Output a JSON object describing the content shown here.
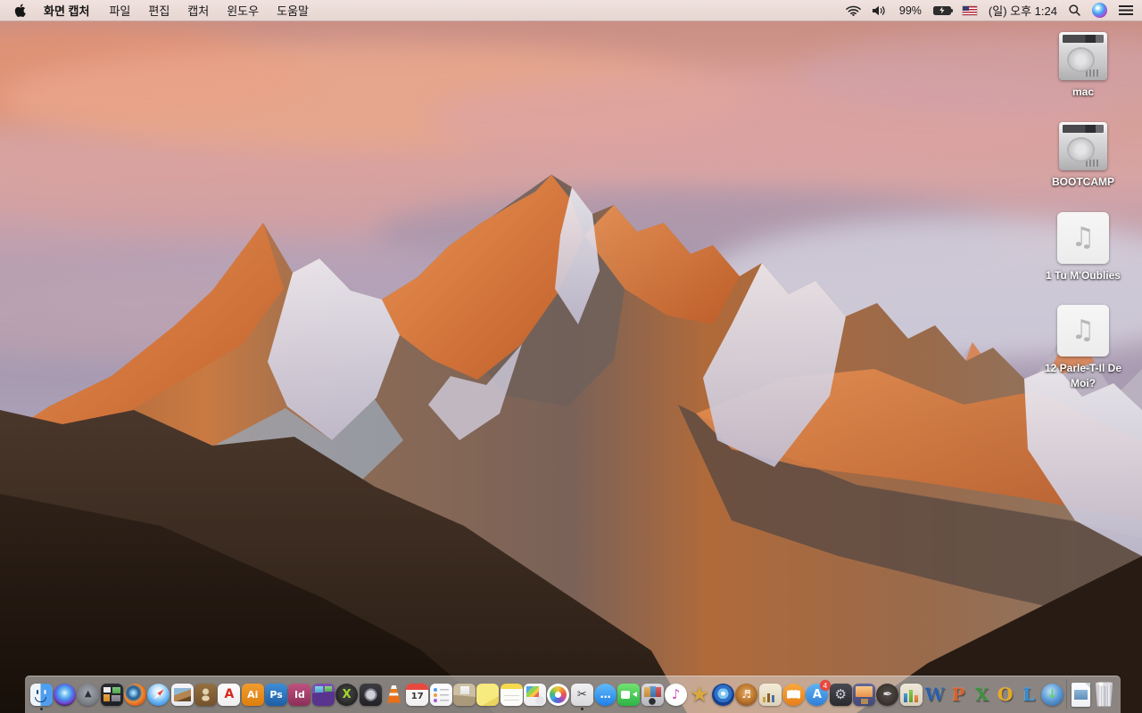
{
  "menu_bar": {
    "menus": [
      {
        "label": "화면 캡처",
        "app": true
      },
      {
        "label": "파일"
      },
      {
        "label": "편집"
      },
      {
        "label": "캡처"
      },
      {
        "label": "윈도우"
      },
      {
        "label": "도움말"
      }
    ],
    "status": {
      "battery_percent": "99%",
      "clock": "(일) 오후 1:24"
    },
    "status_icons": [
      "wifi-icon",
      "volume-icon",
      "battery-charging-icon",
      "us-flag-input-icon",
      "spotlight-search-icon",
      "siri-icon",
      "notification-center-icon"
    ]
  },
  "desktop": {
    "icons": [
      {
        "id": "mac",
        "label": "mac",
        "type": "drive"
      },
      {
        "id": "bootcamp",
        "label": "BOOTCAMP",
        "type": "drive"
      },
      {
        "id": "tu-moublies",
        "label": "1 Tu M'Oublies",
        "type": "audio",
        "glyph": "♫"
      },
      {
        "id": "parle-t-il-de-moi",
        "label": "12 Parle-T-Il De Moi?",
        "type": "audio",
        "glyph": "♫"
      }
    ]
  },
  "dock": {
    "items": [
      {
        "name": "finder",
        "cls": "finder",
        "bg": "linear-gradient(90deg,#eff4f9 0 46%,#4f9ef0 46%)",
        "running": true
      },
      {
        "name": "siri",
        "cls": "circle",
        "bg": "radial-gradient(circle at 50% 42%,#eaf6ff 0%,#7cc5f2 20%,#4383e8 45%,#7a3fd0 63%,#191921 80%)"
      },
      {
        "name": "launchpad",
        "cls": "circle",
        "bg": "radial-gradient(circle at 50% 42%,#a6abb3 0%,#787d85 65%,#585d64 100%)",
        "glyph": "▲",
        "glyphColor": "#2c3036",
        "glyphSize": 10
      },
      {
        "name": "mission-control",
        "bg": "linear-gradient(#ededed,#ededed) 3px 4px/8px 6px no-repeat,linear-gradient(#7bc47b,#4fa84f) 13px 4px/9px 7px no-repeat,linear-gradient(#e8a23f,#d68a2a) 3px 12px/7px 8px no-repeat,linear-gradient(#9a9aa4,#7a7a84) 12px 13px/10px 7px no-repeat,linear-gradient(#2a2c31,#1e2024)"
      },
      {
        "name": "firefox",
        "cls": "circle",
        "bg": "radial-gradient(circle at 42% 42%,#cfe8f7 0%,#6fb2dd 15%,#2a5d8f 30%,#3a6fa0 38%,#ef8f2e 48%,#e2621c 68%,#c24e12 100%)"
      },
      {
        "name": "safari",
        "cls": "circle safari",
        "bg": "radial-gradient(circle at 50% 35%,#f8fbff 0%,#d4ebfb 25%,#62b2f2 60%,#1f70d0 100%)"
      },
      {
        "name": "preview",
        "bg": "linear-gradient(160deg,#90b8d6 0 38%,#b5854f 38% 72%,#6b4a2a 72%) 3px 5px/19px 15px no-repeat,linear-gradient(#f6f6f8,#e8e8ec)"
      },
      {
        "name": "contacts",
        "bg": "radial-gradient(circle at 50% 36%,#e2d2ae 0 3px,transparent 4px) no-repeat,radial-gradient(ellipse 7px 5px at 50% 66%,#e2d2ae 60%,transparent 62%) no-repeat,linear-gradient(#95703f,#74522c)"
      },
      {
        "name": "acrobat-reader",
        "bg": "linear-gradient(#fdfdfd,#eeeeee)",
        "glyph": "A",
        "glyphColor": "#d6281e",
        "glyphSize": 14,
        "bold": true
      },
      {
        "name": "illustrator",
        "bg": "linear-gradient(#f09c2e,#de7f0e)",
        "glyph": "Ai",
        "glyphColor": "#ffffff",
        "glyphSize": 11,
        "bold": true
      },
      {
        "name": "photoshop",
        "bg": "linear-gradient(#3e8ed6,#1e5ea6)",
        "glyph": "Ps",
        "glyphColor": "#ffffff",
        "glyphSize": 11,
        "bold": true
      },
      {
        "name": "indesign",
        "bg": "linear-gradient(#bf5280,#8c2f58)",
        "glyph": "Id",
        "glyphColor": "#ffffff",
        "glyphSize": 11,
        "bold": true
      },
      {
        "name": "toast-titanium",
        "bg": "linear-gradient(#7fd8e8,#4fa8c8) 3px 3px/9px 7px no-repeat,linear-gradient(#8fd87f,#4fa84f) 14px 3px/8px 6px no-repeat,linear-gradient(175deg,#7a4fb2 0 40%,#58348e 40%)"
      },
      {
        "name": "macx-dvd",
        "cls": "circle",
        "bg": "radial-gradient(circle at 50% 45%,#3a3a3a 0 35%,#111111 100%)",
        "glyph": "X",
        "glyphColor": "#a4d92e",
        "glyphSize": 13,
        "bold": true
      },
      {
        "name": "disc-burner",
        "bg": "radial-gradient(circle at 50% 50%,#d0d0d8 0 5px,#888890 5px 7px,transparent 7px) no-repeat,linear-gradient(#3c3c42,#222226)"
      },
      {
        "name": "vlc",
        "cls": "vlc",
        "bg": "transparent"
      },
      {
        "name": "calendar",
        "cls": "calendar",
        "bg": "linear-gradient(#fcfcfc,#f0f0f0)",
        "glyph": "17",
        "glyphColor": "#333333",
        "glyphSize": 10
      },
      {
        "name": "reminders",
        "bg": "radial-gradient(circle at 6px 7px,#4f9fe8 1.8px,transparent 2.3px),radial-gradient(circle at 6px 13px,#e8a23f 1.8px,transparent 2.3px),radial-gradient(circle at 6px 19px,#9f5fd6 1.8px,transparent 2.3px),linear-gradient(#bfbfc4,#bfbfc4) 11px 6px/10px 1.5px no-repeat,linear-gradient(#bfbfc4,#bfbfc4) 11px 12px/10px 1.5px no-repeat,linear-gradient(#bfbfc4,#bfbfc4) 11px 18px/10px 1.5px no-repeat,linear-gradient(#ffffff,#f2f2f4)"
      },
      {
        "name": "stuffit-expander",
        "bg": "linear-gradient(#f6f6f6,#e2e2e2) 8px 3px/10px 9px no-repeat,linear-gradient(185deg,#cdbfa2 0 55%,#ab9a7a 55%)"
      },
      {
        "name": "stickies",
        "bg": "linear-gradient(150deg,#f7ea7e 0 72%,#e8d45f 72%)"
      },
      {
        "name": "notes",
        "bg": "linear-gradient(#d9d9d5,#d9d9d5) 4px 13px/17px 1px no-repeat,linear-gradient(#d9d9d5,#d9d9d5) 4px 18px/17px 1px no-repeat,linear-gradient(180deg,#f6d94d 0 6px,#fcfcf9 6px)"
      },
      {
        "name": "image-capture",
        "bg": "linear-gradient(135deg,#4fa8e8 0 30%,#8fd64f 30% 55%,#f5c542 55% 75%,#e8654f 75%) 3px 3px/14px 12px no-repeat,radial-gradient(circle at 18px 19px,#e2e2e8 4.5px,transparent 5px),linear-gradient(#f8f8fa,#ececf0)"
      },
      {
        "name": "photos",
        "cls": "circle photos",
        "bg": "#ffffff"
      },
      {
        "name": "grab-screen-capture",
        "bg": "linear-gradient(#f2f2f4,#d8d8dc)",
        "glyph": "✂",
        "glyphColor": "#3a3a3e",
        "glyphSize": 13,
        "running": true
      },
      {
        "name": "messages",
        "cls": "circle",
        "bg": "linear-gradient(#62baf8,#1f7fe8)",
        "glyph": "…",
        "glyphColor": "#ffffff",
        "glyphSize": 12,
        "bold": true
      },
      {
        "name": "facetime",
        "cls": "facetime",
        "bg": "linear-gradient(#72e273,#2cb445)"
      },
      {
        "name": "photo-booth",
        "bg": "linear-gradient(#e2b45f,#c28a3a) 3px 4px/7px 11px no-repeat,linear-gradient(#5f9fd8,#3a6fa8) 9px 3px/7px 12px no-repeat,linear-gradient(#d65f5f,#a83a3a) 15px 4px/7px 11px no-repeat,radial-gradient(circle at 12px 20px,#2c2c30 3.5px,transparent 4px),linear-gradient(#dcdce2,#b6b6be)"
      },
      {
        "name": "itunes",
        "cls": "circle",
        "bg": "radial-gradient(circle at 50% 45%,#ffffff 55%,#e8f2fa 100%)",
        "glyph": "♪",
        "glyphColor": "#d04fc0",
        "glyphSize": 15
      },
      {
        "name": "imovie",
        "cls": "imovie",
        "glyph": "★",
        "glyphColor": "#d9a93f",
        "glyphSize": 24
      },
      {
        "name": "dvd-player",
        "cls": "circle",
        "bg": "radial-gradient(circle at 50% 45%,#f0f8ff 0 2.5px,#7fc4f0 2.5px 6px,#2f6fc8 6px 10px,#16408c 10px)"
      },
      {
        "name": "garageband",
        "cls": "circle",
        "bg": "radial-gradient(circle at 50% 42%,#e8ab62 0%,#b5712a 55%,#6f4418 100%)",
        "glyph": "♬",
        "glyphColor": "#ffffff",
        "glyphSize": 12
      },
      {
        "name": "office-documents",
        "bg": "linear-gradient(#c9a23f,#c9a23f) 4px 15px/3px 6px no-repeat,linear-gradient(#8a5f2a,#8a5f2a) 9px 11px/3px 10px no-repeat,linear-gradient(#4a6fa8,#4a6fa8) 14px 13px/3px 8px no-repeat,linear-gradient(#f4ecd8,#dcd2ba)"
      },
      {
        "name": "ibooks",
        "cls": "circle book",
        "bg": "linear-gradient(#f7a93c,#e87d1c)"
      },
      {
        "name": "app-store",
        "cls": "circle",
        "bg": "linear-gradient(#5fb2f5,#2e7ed6)",
        "glyph": "A",
        "glyphColor": "#ffffff",
        "glyphSize": 13,
        "bold": true,
        "badge": "4"
      },
      {
        "name": "system-preferences",
        "bg": "linear-gradient(#4a4a52,#29292f)",
        "glyph": "⚙",
        "glyphColor": "#cfcfd6",
        "glyphSize": 15
      },
      {
        "name": "keynote",
        "cls": "keynote",
        "bg": "linear-gradient(#62679a,#424876)"
      },
      {
        "name": "pages",
        "cls": "circle",
        "bg": "radial-gradient(circle at 50% 45%,#57504a 0%,#27221e 100%)",
        "glyph": "✒",
        "glyphColor": "#e0e0e4",
        "glyphSize": 13
      },
      {
        "name": "numbers",
        "bg": "linear-gradient(#4a9fd8,#2f6fa8) 4px 11px/4px 10px no-repeat,linear-gradient(#8fc94f,#5f9f2f) 10px 7px/4px 14px no-repeat,linear-gradient(#e8944f,#c86f2a) 16px 13px/4px 8px no-repeat,linear-gradient(#efe9da,#d8d0bc)"
      },
      {
        "name": "word",
        "cls": "letter",
        "glyph": "W",
        "glyphColor": "#2a5fa8"
      },
      {
        "name": "powerpoint",
        "cls": "letter",
        "glyph": "P",
        "glyphColor": "#d8622a"
      },
      {
        "name": "excel",
        "cls": "letter",
        "glyph": "X",
        "glyphColor": "#3f8f3f"
      },
      {
        "name": "outlook",
        "cls": "letter",
        "glyph": "O",
        "glyphColor": "#e8a81f"
      },
      {
        "name": "lync",
        "cls": "letter",
        "glyph": "L",
        "glyphColor": "#2f8fd6"
      },
      {
        "name": "internet-downloader",
        "cls": "circle",
        "bg": "radial-gradient(circle at 42% 35%,#c2e0f5 0%,#5f9fd8 45%,#28598f 100%)",
        "glyph": "↓",
        "glyphColor": "#59d659",
        "glyphSize": 13,
        "bold": true
      },
      {
        "type": "separator"
      },
      {
        "name": "jpeg-document",
        "cls": "page",
        "bg": "linear-gradient(#8fb8d8,#5f8fb8) 3px 8px/15px 11px no-repeat,linear-gradient(#fdfdff,#eef0f4)"
      },
      {
        "name": "trash",
        "cls": "trash",
        "bg": "repeating-linear-gradient(90deg,rgba(110,110,120,.3) 0 1px,transparent 1px 3.5px),linear-gradient(90deg,#c4c4ca,#f2f2f6 35%,#cacad0 55%,#eeeef2 75%,#b6b6be)"
      }
    ]
  }
}
